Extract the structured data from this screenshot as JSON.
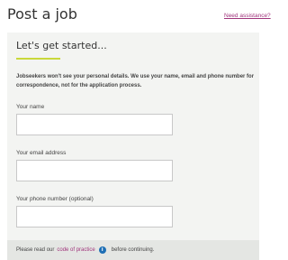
{
  "header": {
    "title": "Post a job",
    "help_link": "Need assistance?"
  },
  "form": {
    "heading": "Let's get started...",
    "intro": "Jobseekers won't see your personal details. We use your name, email and phone number for correspondence, not for the application process.",
    "fields": [
      {
        "label": "Your name",
        "value": "",
        "placeholder": ""
      },
      {
        "label": "Your email address",
        "value": "",
        "placeholder": ""
      },
      {
        "label": "Your phone number (optional)",
        "value": "",
        "placeholder": ""
      }
    ]
  },
  "notice": {
    "prefix": "Please read our",
    "link": "code of practice",
    "suffix": "before continuing.",
    "icon": "info-icon"
  },
  "colors": {
    "accent": "#c9d83a",
    "link": "#a0357c",
    "info": "#1e6fb5"
  }
}
